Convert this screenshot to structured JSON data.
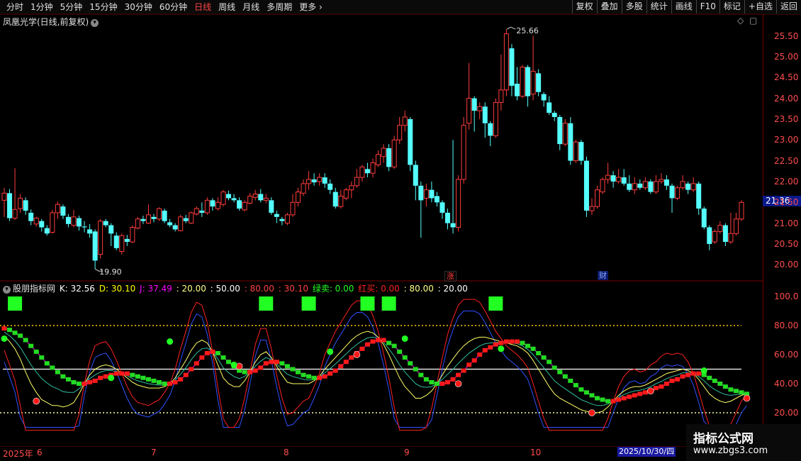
{
  "toolbar": {
    "periods": [
      "分时",
      "1分钟",
      "5分钟",
      "15分钟",
      "30分钟",
      "60分钟",
      "日线",
      "周线",
      "月线",
      "多周期",
      "更多"
    ],
    "active_period": "日线",
    "more_arrow": "›",
    "right_buttons": [
      "复权",
      "叠加",
      "多股",
      "统计",
      "画线",
      "F10",
      "标记",
      "+自选",
      "返回"
    ]
  },
  "main_chart": {
    "title": "凤凰光学(日线,前复权)",
    "current_price": "21.36",
    "high_label": "25.66",
    "low_label": "19.90",
    "price_axis": [
      "25.50",
      "25.00",
      "24.50",
      "24.00",
      "23.50",
      "23.00",
      "22.50",
      "22.00",
      "21.50",
      "21.00",
      "20.50",
      "20.00"
    ],
    "badge_up": "涨",
    "badge_fin": "财"
  },
  "indicator": {
    "name": "股朋指标网",
    "k_label": "K: 32.56",
    "d_label": "D: 30.10",
    "j_label": "J: 37.49",
    "v1": ": 20.00",
    "v2": ": 50.00",
    "v3": ": 80.00",
    "v4": ": 30.10",
    "sell_label": "绿卖: 0.00",
    "buy_label": "红买: 0.00",
    "v5": ": 80.00",
    "v6": ": 20.00",
    "axis": [
      "100.0",
      "80.00",
      "60.00",
      "40.00",
      "20.00"
    ]
  },
  "date_axis": {
    "labels": [
      "2025年",
      "6",
      "7",
      "8",
      "9",
      "10"
    ],
    "selected": "2025/10/30/四"
  },
  "watermark": {
    "line1": "指标公式网",
    "line2": "www.zbgs3.com"
  },
  "colors": {
    "up": "#ff3c3c",
    "down": "#54ffff",
    "k": "#ffffff",
    "d": "#ffff00",
    "j": "#ff00ff",
    "accent_red": "#ff2020",
    "accent_green": "#22ff22"
  },
  "chart_data": {
    "type": "candlestick",
    "candles": [
      [
        21.55,
        21.72,
        21.15,
        21.85
      ],
      [
        21.72,
        21.12,
        21.05,
        21.82
      ],
      [
        21.12,
        21.33,
        21.08,
        22.32
      ],
      [
        21.35,
        21.6,
        21.25,
        21.7
      ],
      [
        21.55,
        21.3,
        21.2,
        21.62
      ],
      [
        21.25,
        21.05,
        20.95,
        21.33
      ],
      [
        20.98,
        21.12,
        20.92,
        21.15
      ],
      [
        21.05,
        20.9,
        20.8,
        21.1
      ],
      [
        20.88,
        20.75,
        20.7,
        20.95
      ],
      [
        20.78,
        21.25,
        20.75,
        21.32
      ],
      [
        21.25,
        21.45,
        21.1,
        21.52
      ],
      [
        21.4,
        21.18,
        21.1,
        21.45
      ],
      [
        21.15,
        20.98,
        20.9,
        21.22
      ],
      [
        20.95,
        21.15,
        20.9,
        21.32
      ],
      [
        21.12,
        20.92,
        20.82,
        21.18
      ],
      [
        20.92,
        20.9,
        20.78,
        21.05
      ],
      [
        20.85,
        20.75,
        20.65,
        20.98
      ],
      [
        20.8,
        20.1,
        19.9,
        20.85
      ],
      [
        20.25,
        21.05,
        20.15,
        21.1
      ],
      [
        21.05,
        20.95,
        20.9,
        21.1
      ],
      [
        20.95,
        20.75,
        20.45,
        21.0
      ],
      [
        20.7,
        20.4,
        20.35,
        20.78
      ],
      [
        20.32,
        20.7,
        20.25,
        20.75
      ],
      [
        20.62,
        20.55,
        20.45,
        20.72
      ],
      [
        20.55,
        20.9,
        20.52,
        20.95
      ],
      [
        20.88,
        21.1,
        20.85,
        21.15
      ],
      [
        21.1,
        21.05,
        20.98,
        21.18
      ],
      [
        21.0,
        21.2,
        20.98,
        21.45
      ],
      [
        21.15,
        21.1,
        21.02,
        21.22
      ],
      [
        21.1,
        21.35,
        21.05,
        21.38
      ],
      [
        21.3,
        21.05,
        21.0,
        21.35
      ],
      [
        21.02,
        20.95,
        20.9,
        21.1
      ],
      [
        20.95,
        20.85,
        20.8,
        21.0
      ],
      [
        20.82,
        21.15,
        20.8,
        21.2
      ],
      [
        21.12,
        21.05,
        21.0,
        21.2
      ],
      [
        21.0,
        21.25,
        20.98,
        21.28
      ],
      [
        21.22,
        21.35,
        21.18,
        21.4
      ],
      [
        21.3,
        21.25,
        21.15,
        21.5
      ],
      [
        21.25,
        21.55,
        21.2,
        21.62
      ],
      [
        21.55,
        21.4,
        21.3,
        21.6
      ],
      [
        21.35,
        21.5,
        21.3,
        21.62
      ],
      [
        21.45,
        21.75,
        21.4,
        21.8
      ],
      [
        21.7,
        21.6,
        21.55,
        21.78
      ],
      [
        21.6,
        21.55,
        21.5,
        21.7
      ],
      [
        21.55,
        21.35,
        21.3,
        21.62
      ],
      [
        21.32,
        21.5,
        21.28,
        21.55
      ],
      [
        21.48,
        21.65,
        21.45,
        21.72
      ],
      [
        21.62,
        21.7,
        21.55,
        21.8
      ],
      [
        21.7,
        21.55,
        21.5,
        21.82
      ],
      [
        21.55,
        21.6,
        21.48,
        21.7
      ],
      [
        21.55,
        21.25,
        21.2,
        21.62
      ],
      [
        21.22,
        21.15,
        21.0,
        21.3
      ],
      [
        21.1,
        21.05,
        20.95,
        21.15
      ],
      [
        21.0,
        21.2,
        20.95,
        21.25
      ],
      [
        21.2,
        21.5,
        21.15,
        21.7
      ],
      [
        21.5,
        21.75,
        21.4,
        21.85
      ],
      [
        21.72,
        21.95,
        21.65,
        22.05
      ],
      [
        21.95,
        22.05,
        21.8,
        22.25
      ],
      [
        22.05,
        21.98,
        21.9,
        22.2
      ],
      [
        22.0,
        22.1,
        21.9,
        22.2
      ],
      [
        22.1,
        21.95,
        21.85,
        22.2
      ],
      [
        21.95,
        21.8,
        21.7,
        22.05
      ],
      [
        21.75,
        21.4,
        21.35,
        21.85
      ],
      [
        21.4,
        21.65,
        21.35,
        21.8
      ],
      [
        21.6,
        21.8,
        21.55,
        21.85
      ],
      [
        21.8,
        21.9,
        21.6,
        22.0
      ],
      [
        21.9,
        22.1,
        21.85,
        22.3
      ],
      [
        22.1,
        22.35,
        22.0,
        22.4
      ],
      [
        22.3,
        22.2,
        22.1,
        22.45
      ],
      [
        22.2,
        22.45,
        22.1,
        22.55
      ],
      [
        22.4,
        22.65,
        22.35,
        22.75
      ],
      [
        22.6,
        22.8,
        22.45,
        22.9
      ],
      [
        22.8,
        22.35,
        22.25,
        22.9
      ],
      [
        22.35,
        23.0,
        22.3,
        23.1
      ],
      [
        23.0,
        23.35,
        22.9,
        23.55
      ],
      [
        23.35,
        23.55,
        23.2,
        23.7
      ],
      [
        23.5,
        22.4,
        22.25,
        23.55
      ],
      [
        22.4,
        21.9,
        21.55,
        22.5
      ],
      [
        21.9,
        21.55,
        20.65,
        22.0
      ],
      [
        21.6,
        21.8,
        21.4,
        21.95
      ],
      [
        21.8,
        21.6,
        21.5,
        22.0
      ],
      [
        21.65,
        21.5,
        21.4,
        21.75
      ],
      [
        21.5,
        21.25,
        21.1,
        21.55
      ],
      [
        21.25,
        21.0,
        20.85,
        21.35
      ],
      [
        21.0,
        20.9,
        20.75,
        23.0
      ],
      [
        20.9,
        22.05,
        20.8,
        22.15
      ],
      [
        22.05,
        23.35,
        21.95,
        23.55
      ],
      [
        23.4,
        24.0,
        23.25,
        24.85
      ],
      [
        24.0,
        23.7,
        23.2,
        24.05
      ],
      [
        23.7,
        23.8,
        23.5,
        23.9
      ],
      [
        23.8,
        23.4,
        23.05,
        23.9
      ],
      [
        23.4,
        23.1,
        22.85,
        23.45
      ],
      [
        23.1,
        23.9,
        23.05,
        24.0
      ],
      [
        23.9,
        24.2,
        23.7,
        25.05
      ],
      [
        24.2,
        25.55,
        24.05,
        25.66
      ],
      [
        25.2,
        24.3,
        24.05,
        25.3
      ],
      [
        24.35,
        24.05,
        23.95,
        24.75
      ],
      [
        24.05,
        24.75,
        24.0,
        24.8
      ],
      [
        24.75,
        24.05,
        23.8,
        24.8
      ],
      [
        24.1,
        24.65,
        23.95,
        25.5
      ],
      [
        24.6,
        24.15,
        24.05,
        24.7
      ],
      [
        24.1,
        23.95,
        23.8,
        24.15
      ],
      [
        23.9,
        23.65,
        23.6,
        24.05
      ],
      [
        23.65,
        23.55,
        23.45,
        23.7
      ],
      [
        23.55,
        22.9,
        22.75,
        23.6
      ],
      [
        22.9,
        23.4,
        22.85,
        23.5
      ],
      [
        23.4,
        22.5,
        22.4,
        23.55
      ],
      [
        22.5,
        22.95,
        22.45,
        23.0
      ],
      [
        22.95,
        22.5,
        22.4,
        23.0
      ],
      [
        22.5,
        21.3,
        21.15,
        22.6
      ],
      [
        21.3,
        21.4,
        21.2,
        21.6
      ],
      [
        21.4,
        21.8,
        21.35,
        21.9
      ],
      [
        21.75,
        22.05,
        21.7,
        22.1
      ],
      [
        22.05,
        22.15,
        21.95,
        22.45
      ],
      [
        22.15,
        22.0,
        21.85,
        22.25
      ],
      [
        22.0,
        22.1,
        21.95,
        22.3
      ],
      [
        22.1,
        21.95,
        21.9,
        22.3
      ],
      [
        21.95,
        21.8,
        21.75,
        22.15
      ],
      [
        21.8,
        21.95,
        21.7,
        22.1
      ],
      [
        21.95,
        21.85,
        21.8,
        22.05
      ],
      [
        21.85,
        22.0,
        21.8,
        22.1
      ],
      [
        22.0,
        21.75,
        21.7,
        22.05
      ],
      [
        21.75,
        22.0,
        21.7,
        22.15
      ],
      [
        22.0,
        22.05,
        21.95,
        22.2
      ],
      [
        22.05,
        21.9,
        21.8,
        22.15
      ],
      [
        21.9,
        21.6,
        21.25,
        21.95
      ],
      [
        21.6,
        21.85,
        21.55,
        21.9
      ],
      [
        21.85,
        22.0,
        21.8,
        22.15
      ],
      [
        21.95,
        21.8,
        21.7,
        22.0
      ],
      [
        21.8,
        21.95,
        21.75,
        22.1
      ],
      [
        21.95,
        21.35,
        21.2,
        22.0
      ],
      [
        21.35,
        20.9,
        20.85,
        21.4
      ],
      [
        20.9,
        20.5,
        20.35,
        20.95
      ],
      [
        20.55,
        20.8,
        20.5,
        20.85
      ],
      [
        20.8,
        20.95,
        20.75,
        21.05
      ],
      [
        20.95,
        20.55,
        20.45,
        21.0
      ],
      [
        20.55,
        20.75,
        20.5,
        21.25
      ],
      [
        20.75,
        21.1,
        20.7,
        21.25
      ],
      [
        21.1,
        21.5,
        21.05,
        21.55
      ]
    ],
    "k": [
      73,
      69,
      64,
      57,
      48,
      40,
      34,
      29,
      27,
      25,
      25,
      24,
      25,
      27,
      33,
      40,
      46,
      50,
      52,
      53,
      52,
      50,
      47,
      44,
      41,
      39,
      38,
      37,
      37,
      37,
      38,
      40,
      44,
      50,
      56,
      63,
      68,
      70,
      68,
      62,
      53,
      44,
      40,
      38,
      38,
      42,
      48,
      55,
      60,
      62,
      58,
      52,
      46,
      41,
      40,
      40,
      40,
      40,
      42,
      45,
      50,
      54,
      58,
      62,
      66,
      70,
      73,
      75,
      76,
      75,
      72,
      67,
      60,
      52,
      44,
      38,
      34,
      30,
      30,
      32,
      35,
      40,
      46,
      52,
      57,
      62,
      66,
      69,
      71,
      72,
      72,
      71,
      70,
      69,
      68,
      67,
      66,
      64,
      61,
      56,
      50,
      44,
      38,
      33,
      30,
      28,
      26,
      24,
      22,
      21,
      20,
      20,
      21,
      24,
      28,
      32,
      35,
      37,
      38,
      38,
      39,
      41,
      43,
      45,
      47,
      48,
      49,
      50,
      49,
      47,
      43,
      38,
      33,
      30,
      28,
      27,
      28,
      30,
      32,
      33
    ],
    "d": [
      78,
      77,
      75,
      73,
      70,
      66,
      62,
      58,
      54,
      51,
      48,
      45,
      43,
      41,
      40,
      40,
      41,
      42,
      44,
      45,
      46,
      47,
      47,
      47,
      46,
      45,
      44,
      43,
      42,
      41,
      40,
      40,
      41,
      43,
      46,
      50,
      54,
      58,
      61,
      62,
      61,
      58,
      55,
      52,
      49,
      48,
      48,
      49,
      51,
      54,
      55,
      55,
      54,
      52,
      50,
      48,
      46,
      45,
      44,
      44,
      45,
      47,
      49,
      52,
      55,
      58,
      61,
      64,
      67,
      69,
      70,
      70,
      68,
      66,
      62,
      58,
      54,
      50,
      46,
      43,
      41,
      40,
      40,
      41,
      43,
      46,
      49,
      53,
      56,
      60,
      63,
      65,
      67,
      68,
      69,
      69,
      69,
      68,
      66,
      64,
      61,
      58,
      55,
      51,
      48,
      45,
      42,
      39,
      36,
      34,
      32,
      30,
      29,
      28,
      28,
      29,
      30,
      31,
      32,
      33,
      34,
      35,
      37,
      38,
      40,
      42,
      43,
      45,
      46,
      47,
      47,
      46,
      44,
      42,
      40,
      38,
      36,
      35,
      34,
      33
    ],
    "buy_markers": [
      [
        6,
        28
      ],
      [
        44,
        52
      ],
      [
        66,
        60
      ],
      [
        85,
        40
      ],
      [
        110,
        20
      ],
      [
        121,
        35
      ],
      [
        139,
        30
      ]
    ],
    "sell_markers": [
      [
        0,
        71
      ],
      [
        20,
        44
      ],
      [
        31,
        69
      ],
      [
        43,
        53
      ],
      [
        61,
        62
      ],
      [
        75,
        71
      ],
      [
        93,
        64
      ],
      [
        131,
        49
      ]
    ],
    "top_squares": [
      2,
      49,
      57,
      68,
      72,
      92
    ]
  }
}
